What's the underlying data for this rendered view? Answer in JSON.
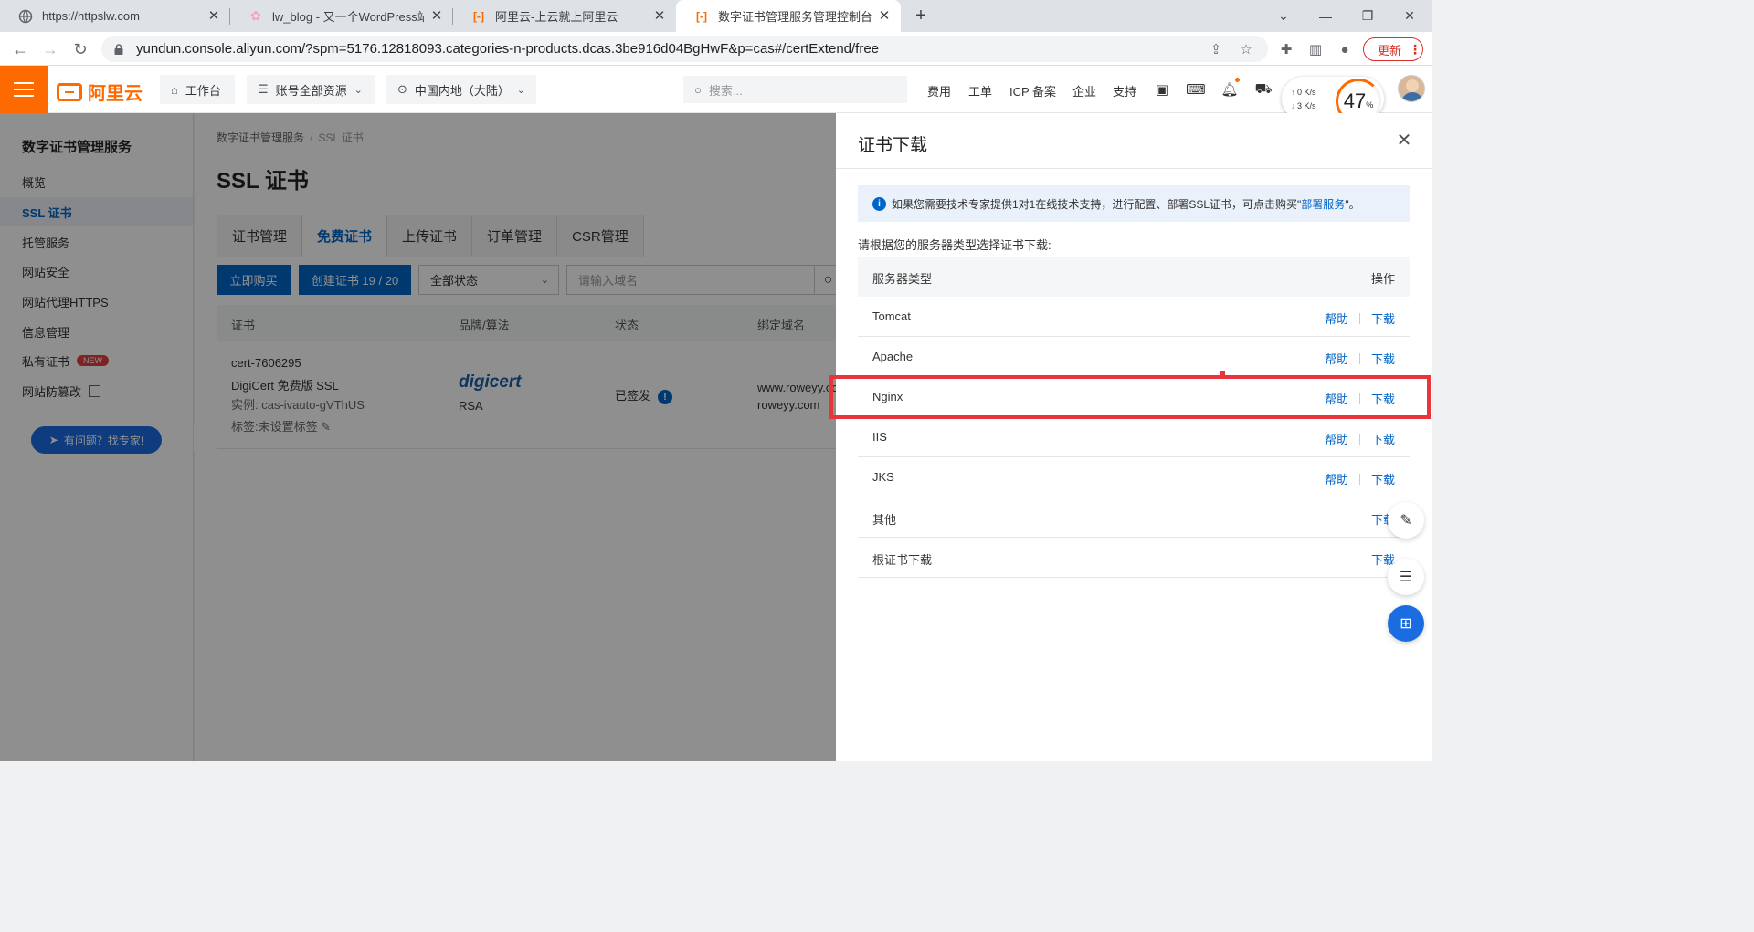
{
  "browser": {
    "tabs": [
      {
        "title": "https://httpslw.com",
        "active": false
      },
      {
        "title": "lw_blog - 又一个WordPress站点",
        "active": false
      },
      {
        "title": "阿里云-上云就上阿里云",
        "active": false
      },
      {
        "title": "数字证书管理服务管理控制台 - SSL",
        "active": true
      }
    ],
    "url": "yundun.console.aliyun.com/?spm=5176.12818093.categories-n-products.dcas.3be916d04BgHwF&p=cas#/certExtend/free",
    "update_label": "更新"
  },
  "header": {
    "logo_text": "阿里云",
    "workbench": "工作台",
    "account_resources": "账号全部资源",
    "region": "中国内地（大陆）",
    "search_placeholder": "搜索...",
    "links": [
      "费用",
      "工单",
      "ICP 备案",
      "企业",
      "支持"
    ],
    "net_up": "0 K/s",
    "net_down": "3 K/s",
    "gauge_value": "47",
    "gauge_unit": "%"
  },
  "sidenav": {
    "title": "数字证书管理服务",
    "items": [
      "概览",
      "SSL 证书",
      "托管服务",
      "网站安全",
      "网站代理HTTPS",
      "信息管理",
      "私有证书",
      "网站防篡改"
    ],
    "new_badge": "NEW",
    "expert_button": "有问题？找专家!"
  },
  "main": {
    "breadcrumb": [
      "数字证书管理服务",
      "SSL 证书"
    ],
    "title": "SSL 证书",
    "tabs": [
      "证书管理",
      "免费证书",
      "上传证书",
      "订单管理",
      "CSR管理"
    ],
    "buy_button": "立即购买",
    "create_button": "创建证书 19 / 20",
    "status_select": "全部状态",
    "domain_placeholder": "请输入域名",
    "columns": [
      "证书",
      "品牌/算法",
      "状态",
      "绑定域名"
    ],
    "row": {
      "cert_id": "cert-7606295",
      "cert_name": "DigiCert 免费版 SSL",
      "instance": "实例: cas-ivauto-gVThUS",
      "tags": "标签:未设置标签",
      "brand": "digicert",
      "algo": "RSA",
      "status": "已签发",
      "domain1": "www.roweyy.com",
      "domain2": "roweyy.com"
    }
  },
  "drawer": {
    "title": "证书下载",
    "info_text": "如果您需要技术专家提供1对1在线技术支持，进行配置、部署SSL证书，可点击购买\"",
    "info_link": "部署服务",
    "info_suffix": "\"。",
    "choose_label": "请根据您的服务器类型选择证书下载:",
    "col_server": "服务器类型",
    "col_action": "操作",
    "help_label": "帮助",
    "download_label": "下载",
    "servers": [
      "Tomcat",
      "Apache",
      "Nginx",
      "IIS",
      "JKS",
      "其他",
      "根证书下载"
    ]
  }
}
